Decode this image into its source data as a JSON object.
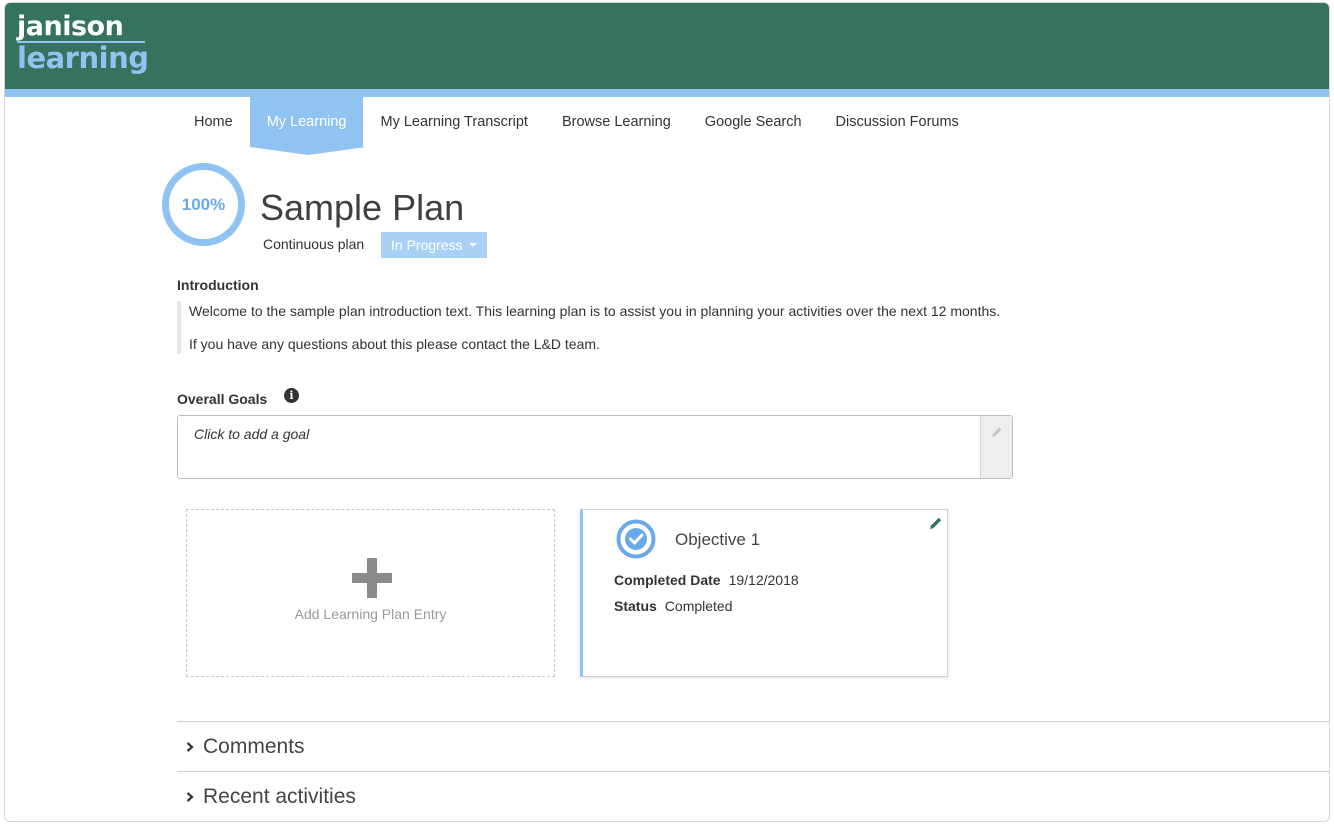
{
  "brand": {
    "line1": "janison",
    "line2": "learning"
  },
  "nav": {
    "items": [
      {
        "label": "Home",
        "active": false
      },
      {
        "label": "My Learning",
        "active": true
      },
      {
        "label": "My Learning Transcript",
        "active": false
      },
      {
        "label": "Browse Learning",
        "active": false
      },
      {
        "label": "Google Search",
        "active": false
      },
      {
        "label": "Discussion Forums",
        "active": false
      }
    ]
  },
  "plan": {
    "progress_label": "100%",
    "progress_fraction": 1.0,
    "title": "Sample Plan",
    "type": "Continuous plan",
    "status": "In Progress"
  },
  "introduction": {
    "heading": "Introduction",
    "lines": [
      "Welcome to the sample plan introduction text. This learning plan is to assist you in planning your activities over the next 12 months.",
      "If you have any questions about this please contact the L&D team."
    ]
  },
  "goals": {
    "heading": "Overall Goals",
    "info_icon": "i",
    "placeholder": "Click to add a goal"
  },
  "entries": {
    "add_label": "Add Learning Plan Entry",
    "objective": {
      "title": "Objective 1",
      "completed_date_label": "Completed Date",
      "completed_date": "19/12/2018",
      "status_label": "Status",
      "status": "Completed"
    }
  },
  "sections": {
    "comments": "Comments",
    "recent_activities": "Recent activities"
  },
  "colors": {
    "header_green": "#34745e",
    "accent_blue": "#8fc4f2",
    "status_blue": "#a9d0f5",
    "check_blue": "#6aa9e8",
    "edit_green": "#34745e"
  }
}
